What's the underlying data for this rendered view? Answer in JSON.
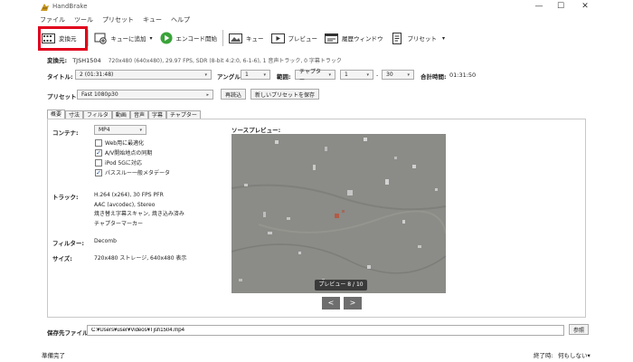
{
  "window": {
    "title": "HandBrake",
    "minimize": "—",
    "maximize": "☐",
    "close": "✕"
  },
  "menu": [
    "ファイル",
    "ツール",
    "プリセット",
    "キュー",
    "ヘルプ"
  ],
  "toolbar": {
    "source": "変換元",
    "add_queue": "キューに追加",
    "add_queue_caret": "▾",
    "encode": "エンコード開始",
    "queue": "キュー",
    "preview": "プレビュー",
    "activity": "履歴ウィンドウ",
    "presets": "プリセット",
    "presets_caret": "▾"
  },
  "source_info": {
    "label": "変換元:",
    "name": "TJSH1504",
    "details": "720x480 (640x480), 29.97 FPS, SDR (8-bit 4:2:0, 6-1-6), 1 音声トラック, 0 字幕トラック"
  },
  "title_row": {
    "title_label": "タイトル:",
    "title_value": "2 (01:31:48)",
    "angle_label": "アングル:",
    "angle_value": "1",
    "range_label": "範囲:",
    "range_type": "チャプター",
    "range_start": "1",
    "range_dash": "-",
    "range_end": "30",
    "duration_label": "合計時間:",
    "duration_value": "01:31:50"
  },
  "preset_row": {
    "label": "プリセット:",
    "value": "Fast 1080p30",
    "reload": "再読込",
    "save_new": "新しいプリセットを保存"
  },
  "tabs": [
    "概要",
    "寸法",
    "フィルタ",
    "動画",
    "音声",
    "字幕",
    "チャプター"
  ],
  "summary": {
    "container_label": "コンテナ:",
    "container_value": "MP4",
    "options": [
      {
        "label": "Web用に最適化",
        "checked": false
      },
      {
        "label": "A/V開始地点の同期",
        "checked": true
      },
      {
        "label": "iPod 5Gに対応",
        "checked": false
      },
      {
        "label": "パススルー一般メタデータ",
        "checked": true
      }
    ],
    "tracks_label": "トラック:",
    "tracks": [
      "H.264 (x264), 30 FPS PFR",
      "AAC (avcodec), Stereo",
      "焼き替え字幕スキャン, 焼き込み済み",
      "チャプターマーカー"
    ],
    "filters_label": "フィルター:",
    "filters_value": "Decomb",
    "size_label": "サイズ:",
    "size_value": "720x480 ストレージ, 640x480 表示"
  },
  "preview": {
    "label": "ソースプレビュー:",
    "badge": "プレビュー 8 / 10",
    "prev": "<",
    "next": ">"
  },
  "destination": {
    "label": "保存先ファイル:",
    "path": "C:¥Users¥user¥Videos¥Tjsh1504.mp4",
    "browse": "参照"
  },
  "status": {
    "text": "準備完了",
    "when_done_label": "終了時:",
    "when_done_value": "何もしない",
    "when_done_caret": "▾"
  }
}
